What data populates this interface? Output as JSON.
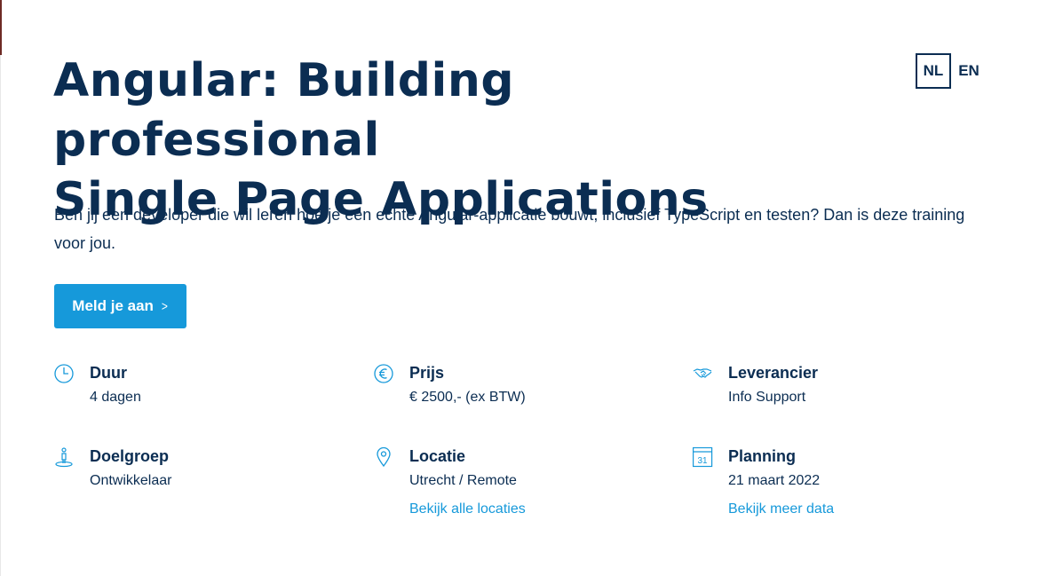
{
  "course": {
    "title_line1": "Angular: Building professional",
    "title_line2": "Single Page Applications",
    "intro": "Ben jij een developer die wil leren hoe je een echte Angular-applicatie bouwt, inclusief TypeScript en testen? Dan is deze training voor jou.",
    "cta_label": "Meld je aan"
  },
  "language": {
    "options": [
      {
        "label": "NL",
        "active": true
      },
      {
        "label": "EN",
        "active": false
      }
    ]
  },
  "details": {
    "duur": {
      "label": "Duur",
      "value": "4 dagen",
      "icon": "clock-icon"
    },
    "prijs": {
      "label": "Prijs",
      "value": "€ 2500,- (ex BTW)",
      "icon": "euro-icon"
    },
    "leverancier": {
      "label": "Leverancier",
      "value": "Info Support",
      "icon": "handshake-icon"
    },
    "doelgroep": {
      "label": "Doelgroep",
      "value": "Ontwikkelaar",
      "icon": "person-pin-icon"
    },
    "locatie": {
      "label": "Locatie",
      "value": "Utrecht / Remote",
      "link": "Bekijk alle locaties",
      "icon": "location-pin-icon"
    },
    "planning": {
      "label": "Planning",
      "value": "21 maart 2022",
      "link": "Bekijk meer data",
      "icon": "calendar-icon",
      "calendar_day": "31"
    }
  },
  "colors": {
    "primary_text": "#0b2d52",
    "accent": "#1699da",
    "background": "#ffffff"
  }
}
